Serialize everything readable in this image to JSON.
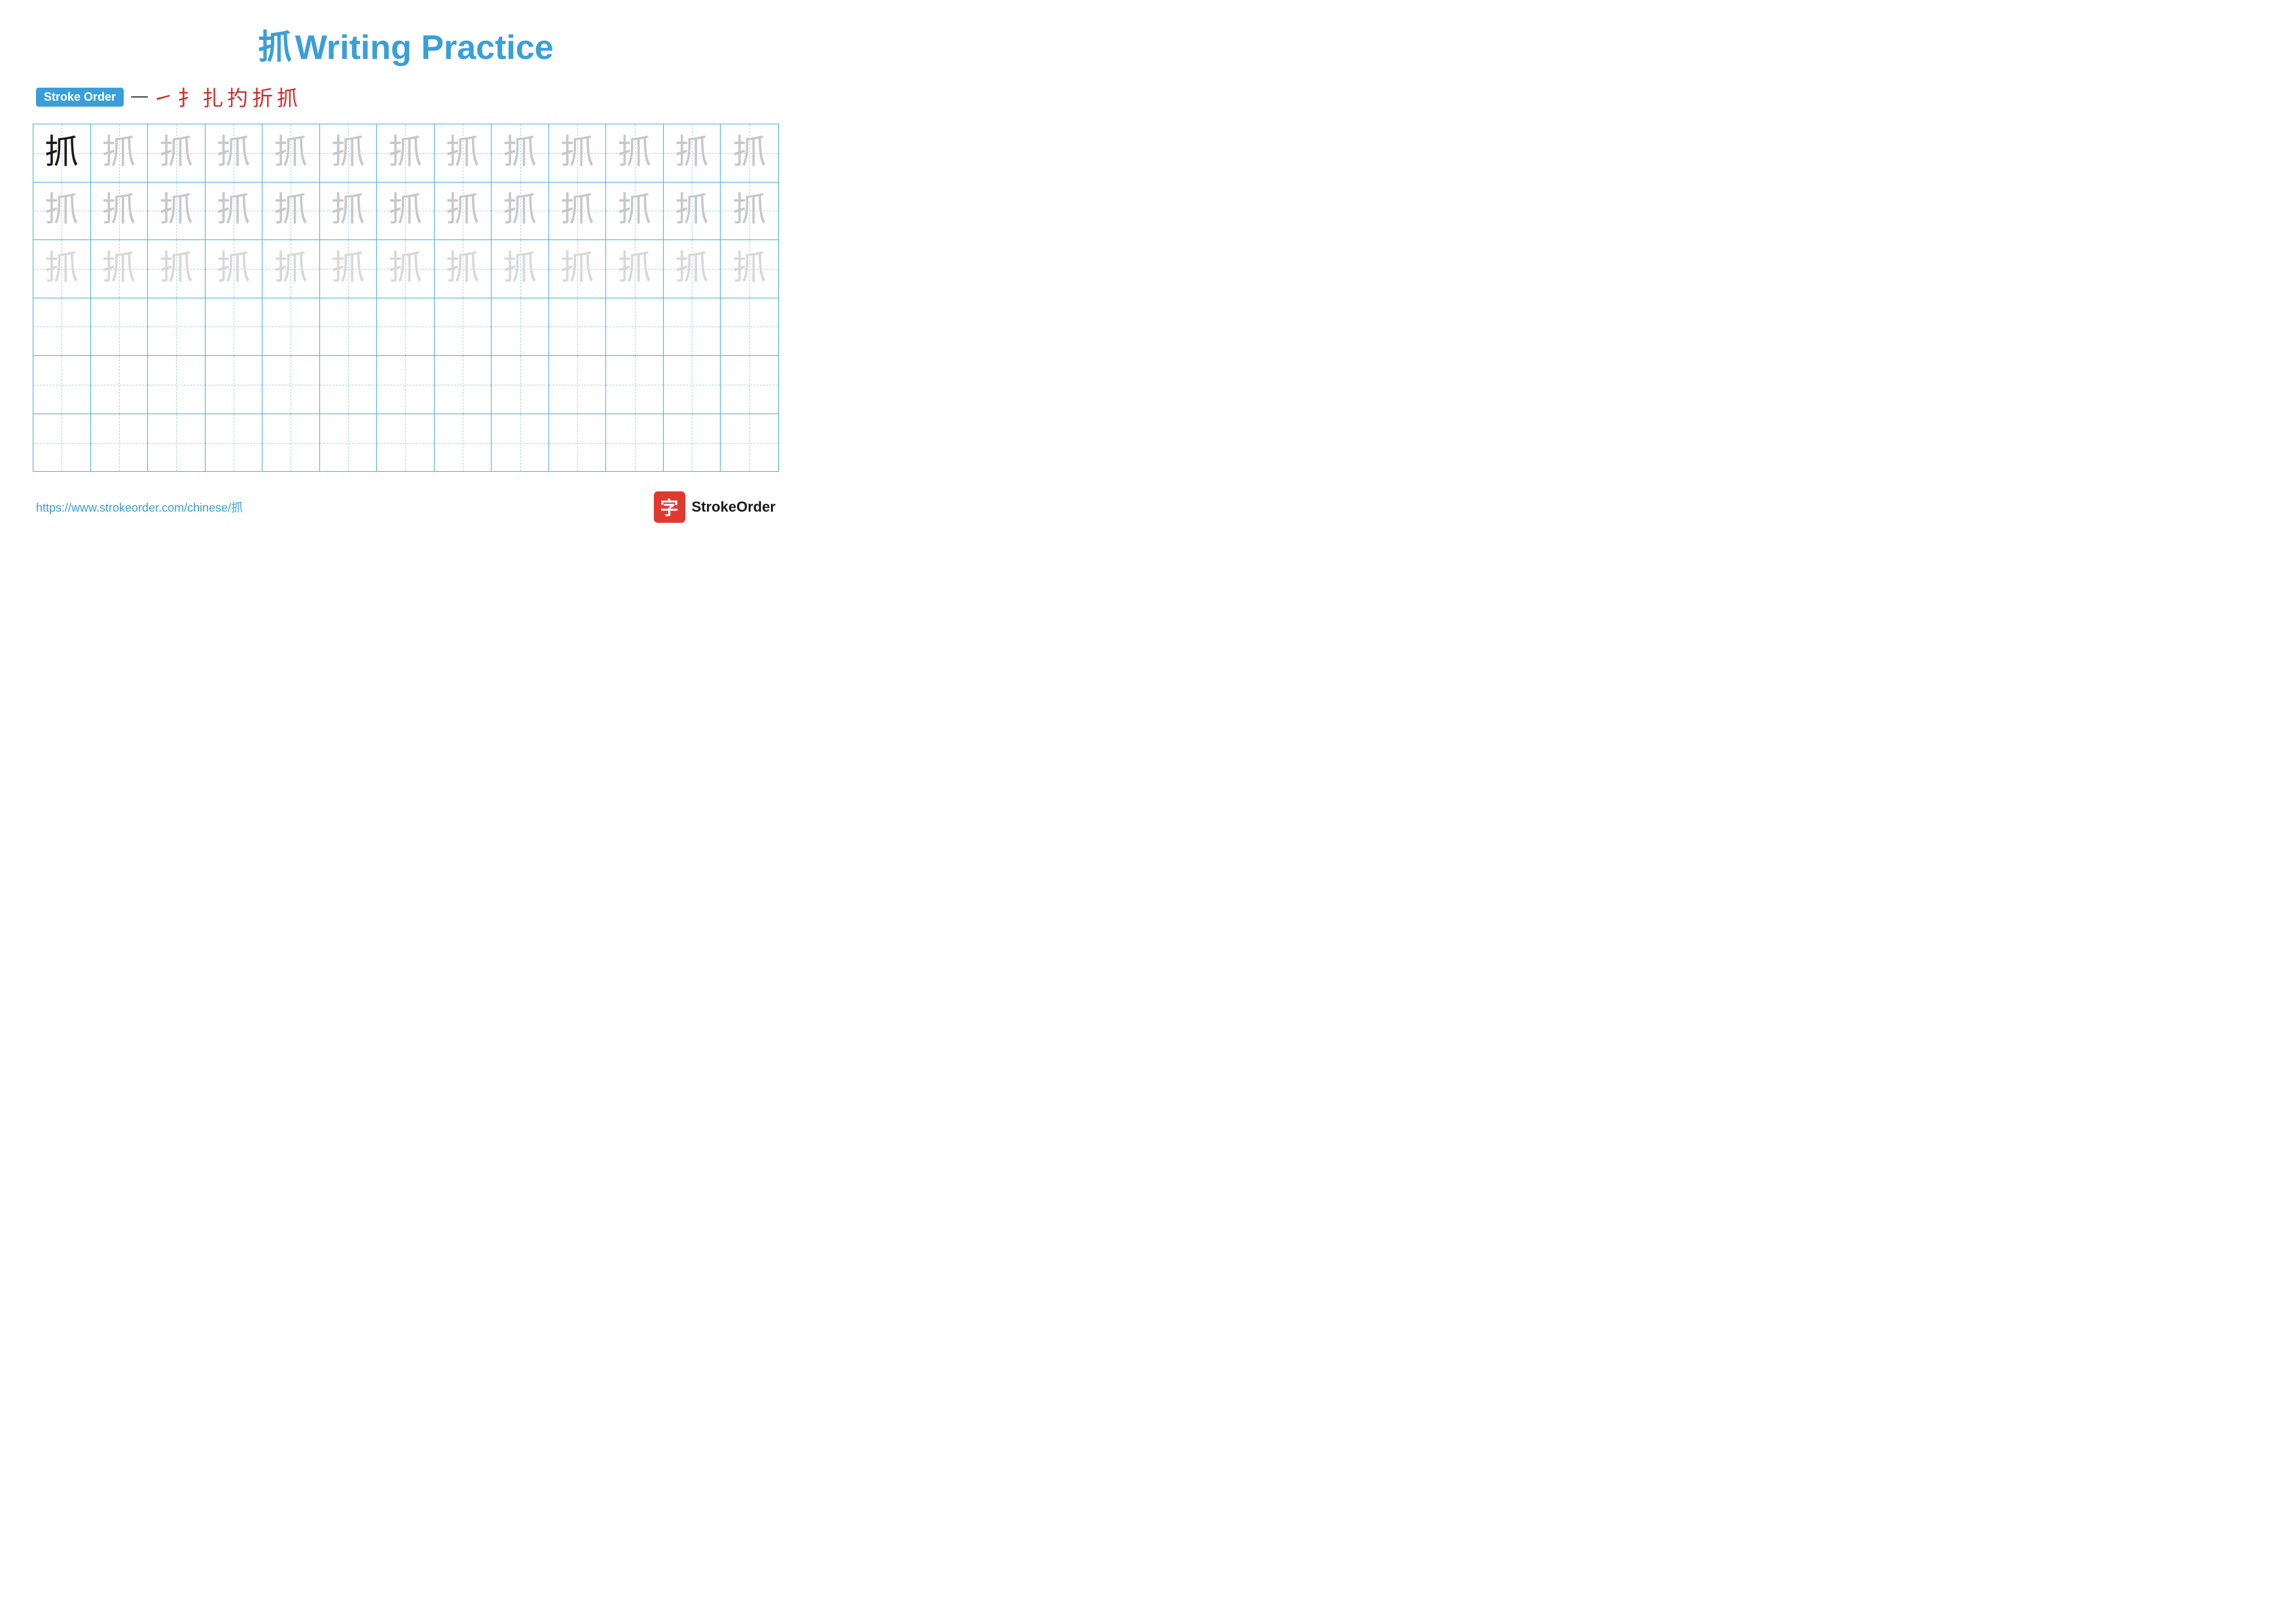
{
  "title": {
    "chinese": "抓",
    "english": "Writing Practice"
  },
  "stroke_order": {
    "badge_label": "Stroke Order",
    "dash": "一",
    "strokes": [
      "㇀",
      "扌",
      "扎",
      "扚",
      "扢",
      "抓"
    ]
  },
  "grid": {
    "rows": 6,
    "cols": 13,
    "character": "抓",
    "row_types": [
      "solid+light",
      "light",
      "very-light",
      "empty",
      "empty",
      "empty"
    ]
  },
  "footer": {
    "url": "https://www.strokeorder.com/chinese/抓",
    "brand_icon": "字",
    "brand_name": "StrokeOrder"
  }
}
